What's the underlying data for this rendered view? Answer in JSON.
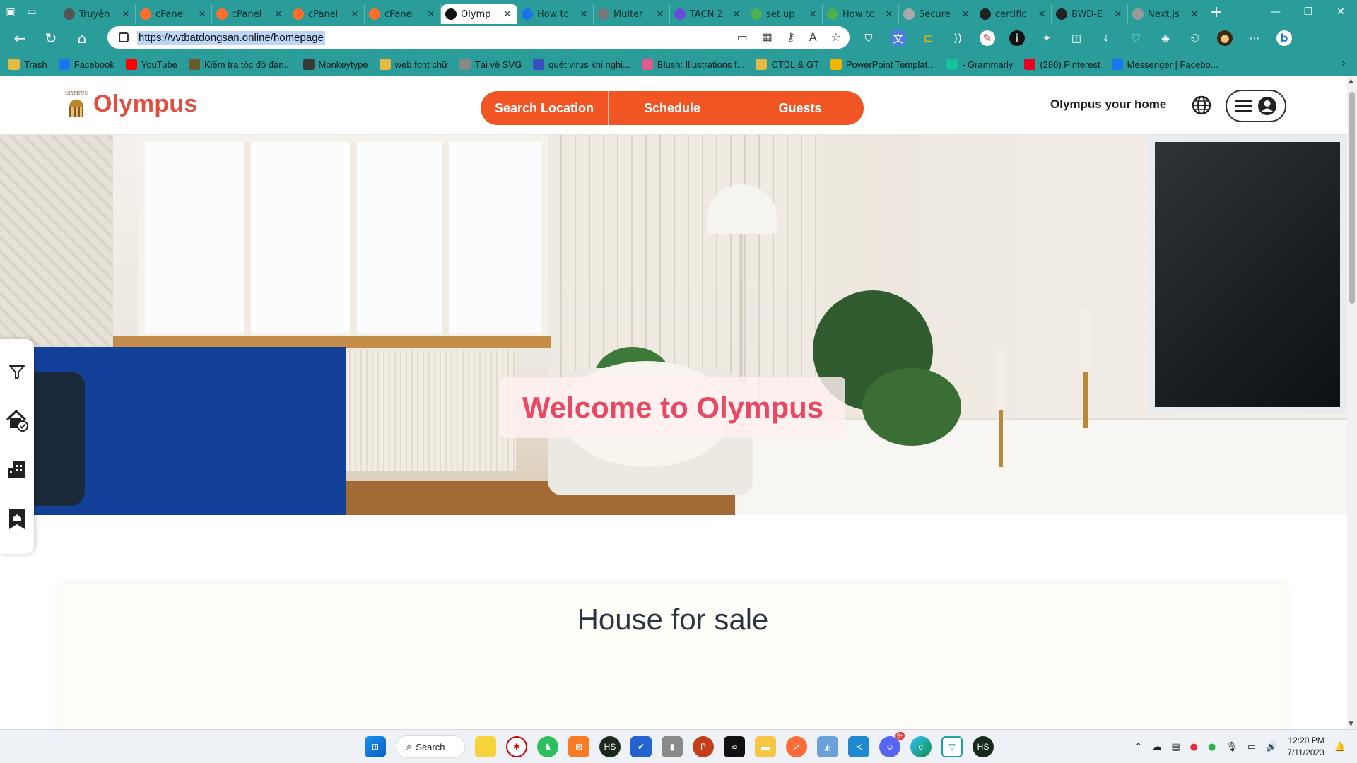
{
  "browser": {
    "tabs": [
      {
        "title": "Truyện",
        "color": "#555"
      },
      {
        "title": "cPanel",
        "color": "#ff6c2c"
      },
      {
        "title": "cPanel",
        "color": "#ff6c2c"
      },
      {
        "title": "cPanel",
        "color": "#ff6c2c"
      },
      {
        "title": "cPanel",
        "color": "#ff6c2c"
      },
      {
        "title": "Olymp",
        "color": "#111",
        "active": true
      },
      {
        "title": "How tc",
        "color": "#1a73e8"
      },
      {
        "title": "Multer",
        "color": "#777"
      },
      {
        "title": "TACN 2",
        "color": "#6a4bd8"
      },
      {
        "title": "set up",
        "color": "#4caf50"
      },
      {
        "title": "How tc",
        "color": "#4caf50"
      },
      {
        "title": "Secure",
        "color": "#aaa"
      },
      {
        "title": "certific",
        "color": "#222"
      },
      {
        "title": "BWD-E",
        "color": "#222"
      },
      {
        "title": "Next.js",
        "color": "#999"
      }
    ],
    "url": "https://vvtbatdongsan.online/homepage",
    "bookmarks": [
      {
        "label": "Trash",
        "color": "#e6b940"
      },
      {
        "label": "Facebook",
        "color": "#1877f2"
      },
      {
        "label": "YouTube",
        "color": "#ff0000"
      },
      {
        "label": "Kiểm tra tốc độ đán...",
        "color": "#6b5a2a"
      },
      {
        "label": "Monkeytype",
        "color": "#3a3a3a"
      },
      {
        "label": "web font chữ",
        "color": "#e6b940"
      },
      {
        "label": "Tải về SVG",
        "color": "#888"
      },
      {
        "label": "quét virus khi nghi...",
        "color": "#3a4fc0"
      },
      {
        "label": "Blush: Illustrations f...",
        "color": "#e05a8a"
      },
      {
        "label": "CTDL & GT",
        "color": "#e6b940"
      },
      {
        "label": "PowerPoint Templat...",
        "color": "#f4b400"
      },
      {
        "label": "- Grammarly",
        "color": "#15c39a"
      },
      {
        "label": "(280) Pinterest",
        "color": "#e60023"
      },
      {
        "label": "Messenger | Facebo...",
        "color": "#1877f2"
      }
    ]
  },
  "site": {
    "brand": "Olympus",
    "logo_small_text": "OLYMPUS",
    "search": {
      "location": "Search Location",
      "schedule": "Schedule",
      "guests": "Guests"
    },
    "tagline": "Olympus your home",
    "hero_title": "Welcome to Olympus",
    "section_title": "House for sale",
    "colors": {
      "accent": "#f05523",
      "brand": "#e14d3f",
      "hero_text": "#e84863"
    }
  },
  "taskbar": {
    "search_label": "Search",
    "time": "12:20 PM",
    "date": "7/11/2023",
    "discord_badge": "9+"
  }
}
